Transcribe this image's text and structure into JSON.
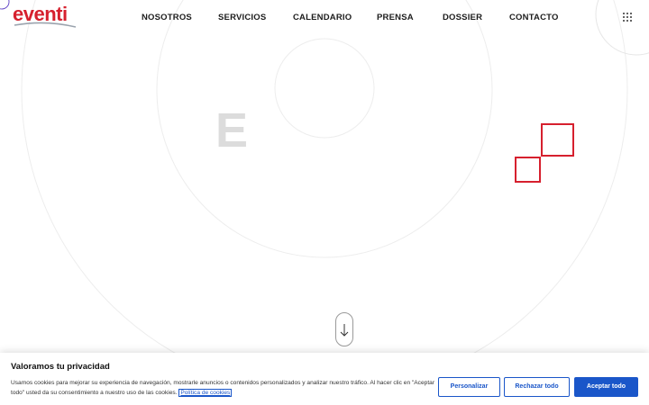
{
  "brand": {
    "logo_text": "eventi",
    "brand_color": "#d6202e"
  },
  "nav": {
    "items": [
      "NOSOTROS",
      "SERVICIOS",
      "CALENDARIO",
      "PRENSA",
      "DOSSIER",
      "CONTACTO"
    ]
  },
  "hero": {
    "letter": "E"
  },
  "icons": {
    "menu": "grid-dots-icon",
    "scroll": "arrow-down-icon"
  },
  "cookie_banner": {
    "title": "Valoramos tu privacidad",
    "text": "Usamos cookies para mejorar su experiencia de navegación, mostrarle anuncios o contenidos personalizados y analizar nuestro tráfico. Al hacer clic en \"Aceptar todo\" usted da su consentimiento a nuestro uso de las cookies.",
    "link_label": "Política de cookies",
    "buttons": {
      "customize": "Personalizar",
      "reject": "Rechazar todo",
      "accept": "Aceptar todo"
    },
    "accent_color": "#1a56c9"
  }
}
